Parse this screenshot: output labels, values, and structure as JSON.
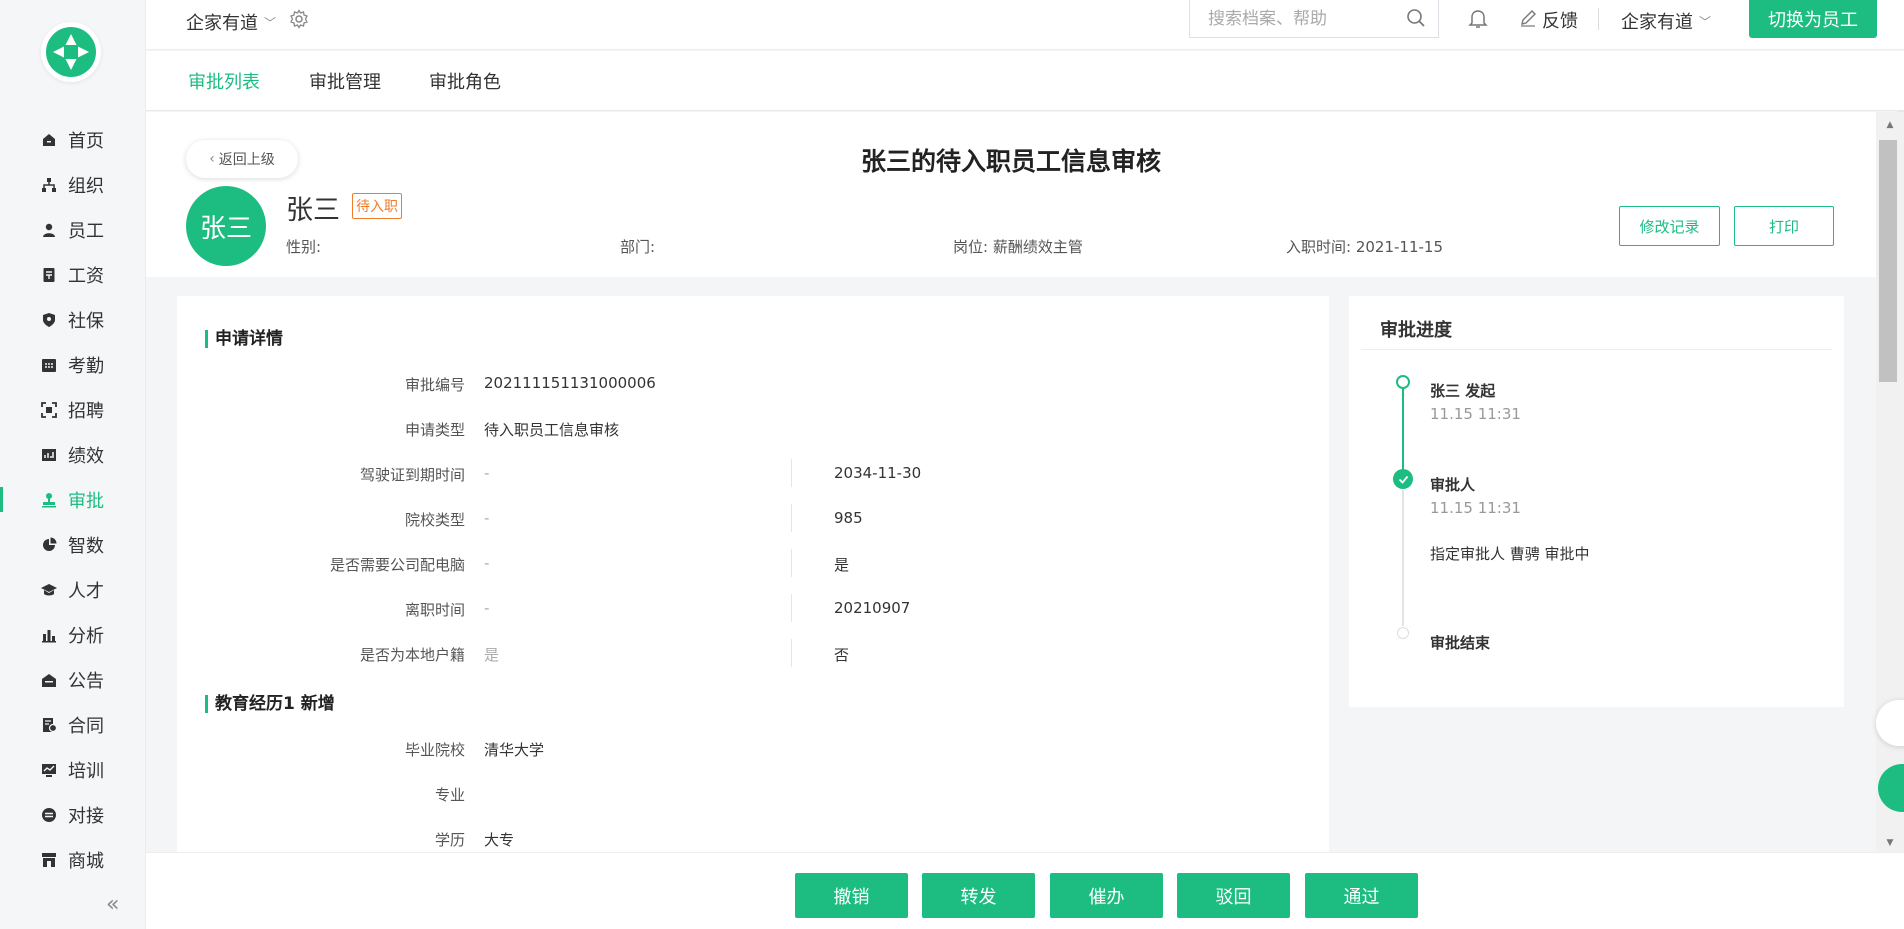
{
  "brand_color": "#1dbd82",
  "sidebar": {
    "items": [
      {
        "label": "首页",
        "icon": "home-icon"
      },
      {
        "label": "组织",
        "icon": "org-tree-icon"
      },
      {
        "label": "员工",
        "icon": "person-icon"
      },
      {
        "label": "工资",
        "icon": "salary-icon"
      },
      {
        "label": "社保",
        "icon": "shield-icon"
      },
      {
        "label": "考勤",
        "icon": "calendar-icon"
      },
      {
        "label": "招聘",
        "icon": "scan-icon"
      },
      {
        "label": "绩效",
        "icon": "performance-chart-icon"
      },
      {
        "label": "审批",
        "icon": "stamp-icon"
      },
      {
        "label": "智数",
        "icon": "pie-chart-icon"
      },
      {
        "label": "人才",
        "icon": "graduation-cap-icon"
      },
      {
        "label": "分析",
        "icon": "bar-chart-icon"
      },
      {
        "label": "公告",
        "icon": "announcement-icon"
      },
      {
        "label": "合同",
        "icon": "contract-icon"
      },
      {
        "label": "培训",
        "icon": "training-board-icon"
      },
      {
        "label": "对接",
        "icon": "connect-icon"
      },
      {
        "label": "商城",
        "icon": "store-icon"
      }
    ],
    "active": "审批",
    "collapse_icon": "double-chevron-left-icon"
  },
  "topbar": {
    "company": "企家有道",
    "search_placeholder": "搜索档案、帮助",
    "feedback": "反馈",
    "company_right": "企家有道",
    "switch_button": "切换为员工"
  },
  "tabs": [
    {
      "label": "审批列表",
      "active": true
    },
    {
      "label": "审批管理",
      "active": false
    },
    {
      "label": "审批角色",
      "active": false
    }
  ],
  "header": {
    "back_label": "返回上级",
    "title": "张三的待入职员工信息审核",
    "avatar_text": "张三",
    "name": "张三",
    "status_badge": "待入职",
    "gender": "性别:",
    "department": "部门:",
    "position": "岗位:  薪酬绩效主管",
    "hire_date": "入职时间:  2021-11-15",
    "history_button": "修改记录",
    "print_button": "打印"
  },
  "details": {
    "section_title": "申请详情",
    "approval_no_label": "审批编号",
    "approval_no": "202111151131000006",
    "apply_type_label": "申请类型",
    "apply_type": "待入职员工信息审核",
    "changes": [
      {
        "label": "驾驶证到期时间",
        "old": "-",
        "new": "2034-11-30"
      },
      {
        "label": "院校类型",
        "old": "-",
        "new": "985"
      },
      {
        "label": "是否需要公司配电脑",
        "old": "-",
        "new": "是"
      },
      {
        "label": "离职时间",
        "old": "-",
        "new": "20210907"
      },
      {
        "label": "是否为本地户籍",
        "old": "是",
        "new": "否"
      }
    ],
    "edu_section_title": "教育经历1 新增",
    "edu": [
      {
        "label": "毕业院校",
        "value": "清华大学"
      },
      {
        "label": "专业",
        "value": ""
      },
      {
        "label": "学历",
        "value": "大专"
      }
    ]
  },
  "progress": {
    "title": "审批进度",
    "start_title": "张三 发起",
    "start_time": "11.15 11:31",
    "approver_title": "审批人",
    "approver_time": "11.15 11:31",
    "approver_detail": "指定审批人  曹骋  审批中",
    "end_title": "审批结束"
  },
  "actions": [
    "撤销",
    "转发",
    "催办",
    "驳回",
    "通过"
  ]
}
